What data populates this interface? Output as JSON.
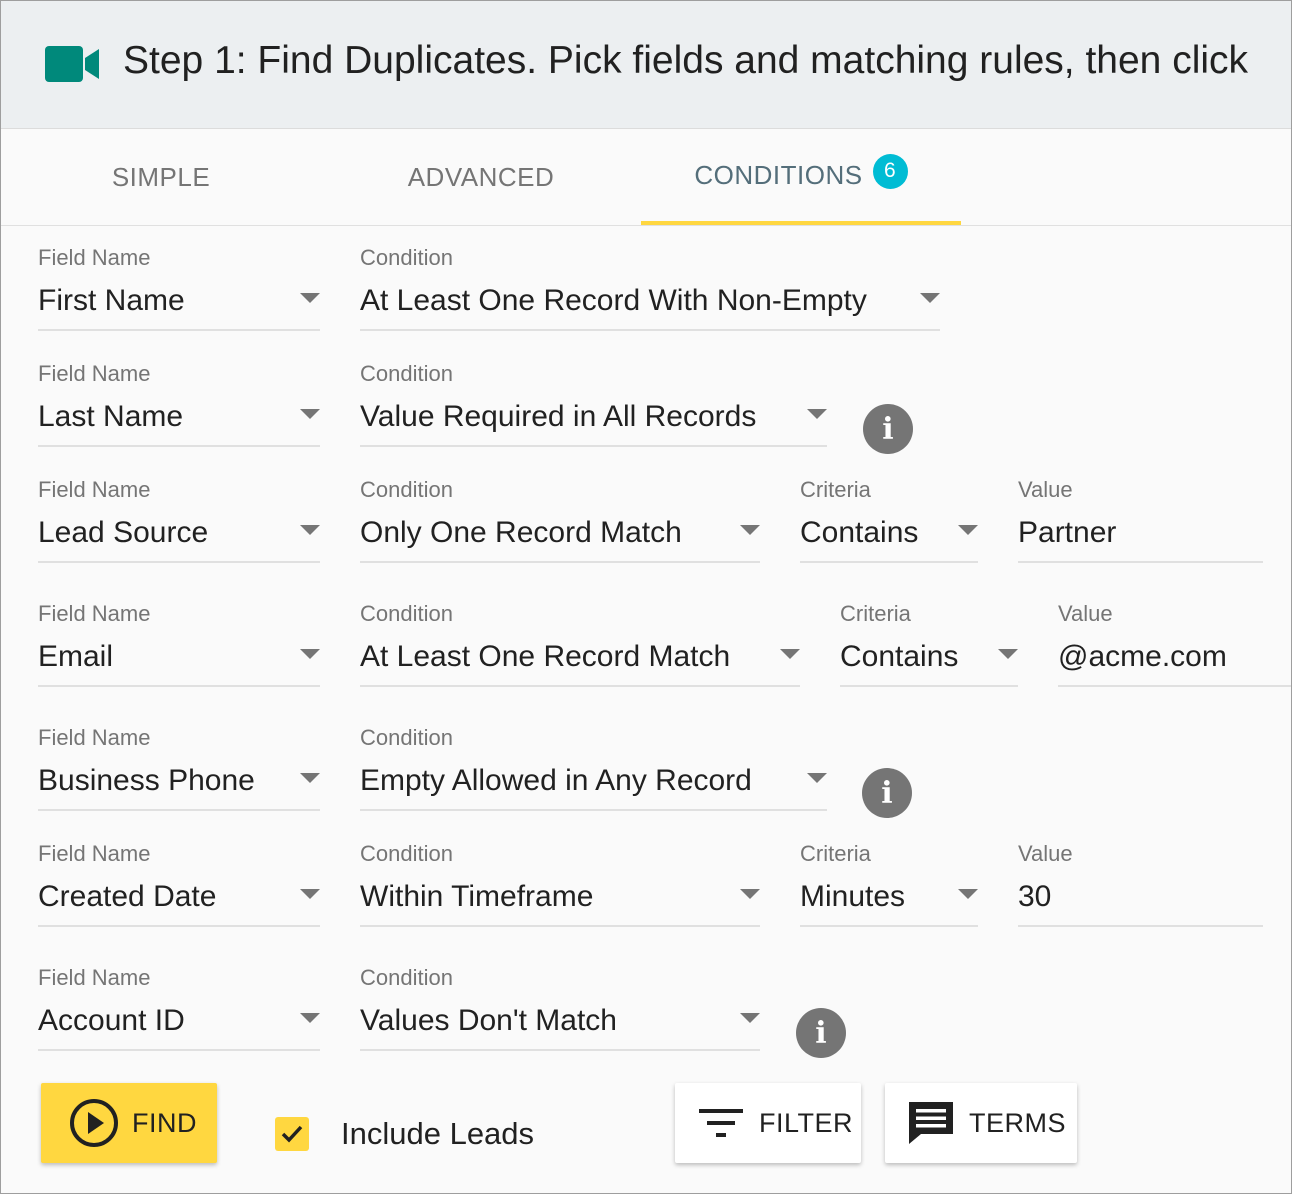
{
  "header": {
    "icon": "video-camera-icon",
    "title": "Step 1: Find Duplicates. Pick fields and matching rules, then click"
  },
  "tabs": [
    {
      "label": "SIMPLE",
      "active": false
    },
    {
      "label": "ADVANCED",
      "active": false
    },
    {
      "label": "CONDITIONS",
      "active": true,
      "badge": "6"
    }
  ],
  "labels": {
    "field_name": "Field Name",
    "condition": "Condition",
    "criteria": "Criteria",
    "value": "Value"
  },
  "conditions": [
    {
      "field": "First Name",
      "condition": "At Least One Record With Non-Empty"
    },
    {
      "field": "Last Name",
      "condition": "Value Required in All Records",
      "info_icon": true
    },
    {
      "field": "Lead Source",
      "condition": "Only One Record Match",
      "criteria": "Contains",
      "value": "Partner"
    },
    {
      "field": "Email",
      "condition": "At Least One Record Match",
      "criteria": "Contains",
      "value": "@acme.com"
    },
    {
      "field": "Business Phone",
      "condition": "Empty Allowed in Any Record",
      "info_icon": true
    },
    {
      "field": "Created Date",
      "condition": "Within Timeframe",
      "criteria": "Minutes",
      "value": "30"
    },
    {
      "field": "Account ID",
      "condition": "Values Don't Match",
      "info_icon": true
    }
  ],
  "footer": {
    "find_label": "FIND",
    "include_leads_label": "Include Leads",
    "include_leads_checked": true,
    "filter_label": "FILTER",
    "terms_label": "TERMS"
  },
  "colors": {
    "accent": "#ffd740",
    "header_icon": "#00897b",
    "badge": "#00bcd4",
    "active_tab_text": "#546e7a"
  }
}
